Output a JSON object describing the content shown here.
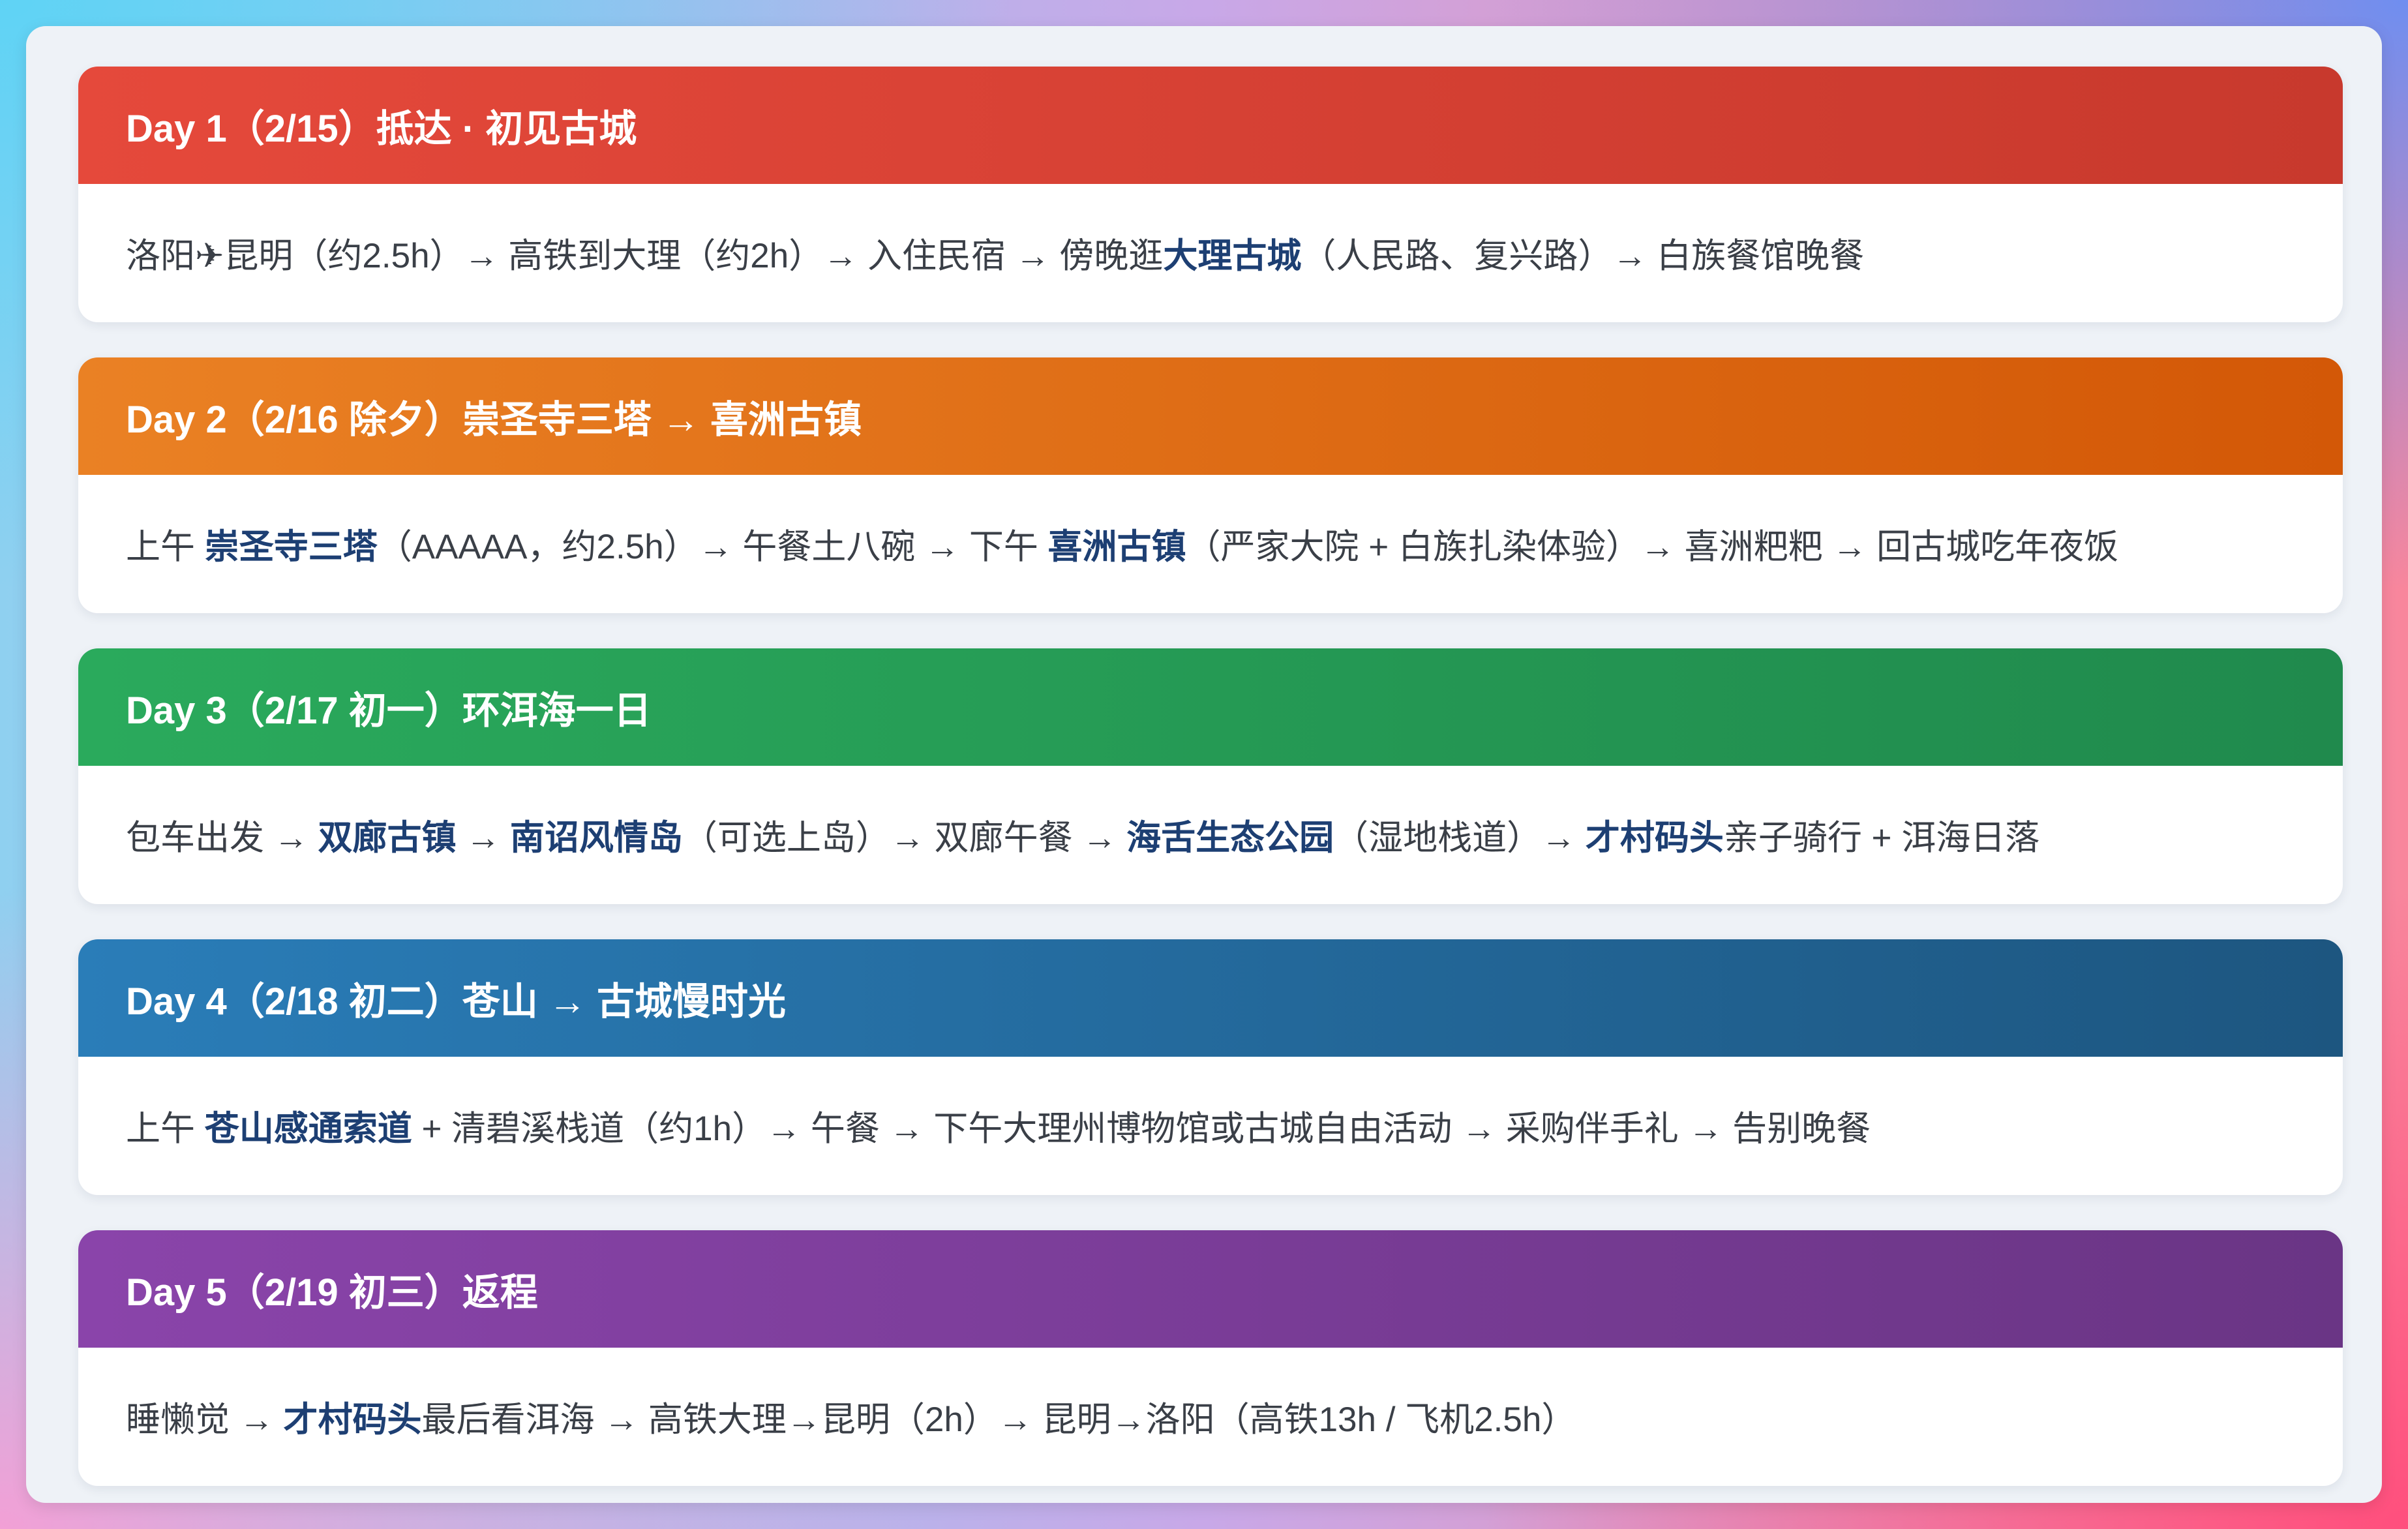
{
  "days": [
    {
      "title": "Day 1（2/15）抵达 · 初见古城",
      "route": [
        {
          "t": "洛阳✈昆明（约2.5h）→ 高铁到大理（约2h）→ 入住民宿 → 傍晚逛"
        },
        {
          "t": "大理古城",
          "hl": true
        },
        {
          "t": "（人民路、复兴路）→ 白族餐馆晚餐"
        }
      ]
    },
    {
      "title": "Day 2（2/16 除夕）崇圣寺三塔 → 喜洲古镇",
      "route": [
        {
          "t": "上午 "
        },
        {
          "t": "崇圣寺三塔",
          "hl": true
        },
        {
          "t": "（AAAAA，约2.5h）→ 午餐土八碗 → 下午 "
        },
        {
          "t": "喜洲古镇",
          "hl": true
        },
        {
          "t": "（严家大院 + 白族扎染体验）→ 喜洲粑粑 → 回古城吃年夜饭"
        }
      ]
    },
    {
      "title": "Day 3（2/17 初一）环洱海一日",
      "route": [
        {
          "t": "包车出发 → "
        },
        {
          "t": "双廊古镇",
          "hl": true
        },
        {
          "t": " → "
        },
        {
          "t": "南诏风情岛",
          "hl": true
        },
        {
          "t": "（可选上岛）→ 双廊午餐 → "
        },
        {
          "t": "海舌生态公园",
          "hl": true
        },
        {
          "t": "（湿地栈道）→ "
        },
        {
          "t": "才村码头",
          "hl": true
        },
        {
          "t": "亲子骑行 + 洱海日落"
        }
      ]
    },
    {
      "title": "Day 4（2/18 初二）苍山 → 古城慢时光",
      "route": [
        {
          "t": "上午 "
        },
        {
          "t": "苍山感通索道",
          "hl": true
        },
        {
          "t": " + 清碧溪栈道（约1h）→ 午餐 → 下午大理州博物馆或古城自由活动 → 采购伴手礼 → 告别晚餐"
        }
      ]
    },
    {
      "title": "Day 5（2/19 初三）返程",
      "route": [
        {
          "t": "睡懒觉 → "
        },
        {
          "t": "才村码头",
          "hl": true
        },
        {
          "t": "最后看洱海 → 高铁大理→昆明（2h）→ 昆明→洛阳（高铁13h / 飞机2.5h）"
        }
      ]
    }
  ]
}
